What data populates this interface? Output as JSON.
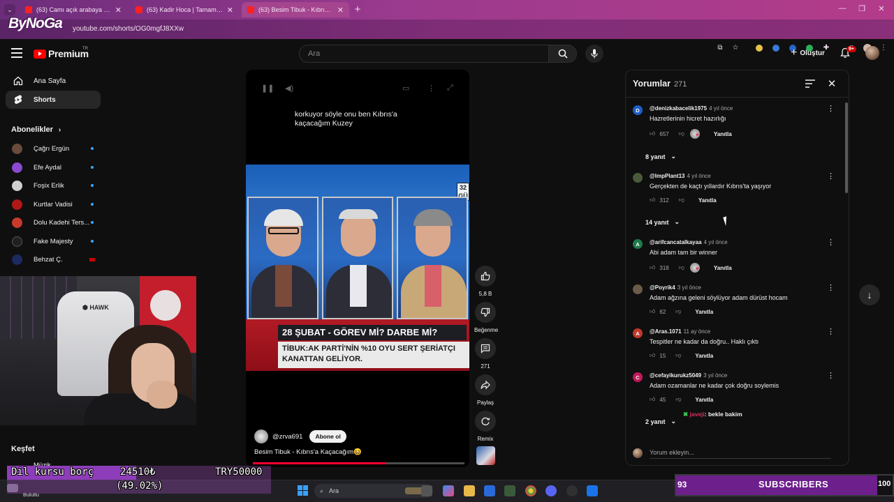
{
  "browser": {
    "tabs": [
      {
        "title": "(63) Camı açık arabaya yavrular",
        "active": false
      },
      {
        "title": "(63) Kadir Hoca | Tamam Olum",
        "active": false
      },
      {
        "title": "(63) Besim Tibuk - Kıbrıs'a K",
        "active": true
      }
    ],
    "brand_overlay": "ByNoGa",
    "url": "youtube.com/shorts/OG0mgfJ8XXw"
  },
  "topbar": {
    "logo_text": "Premium",
    "country": "TR",
    "search_placeholder": "Ara",
    "create_label": "Oluştur",
    "notif_badge": "9+"
  },
  "sidebar": {
    "items": [
      {
        "label": "Ana Sayfa",
        "icon": "home-icon"
      },
      {
        "label": "Shorts",
        "icon": "shorts-icon"
      }
    ],
    "subscriptions_heading": "Abonelikler",
    "subscriptions": [
      {
        "name": "Çağrı Ergün",
        "color": "#6a4a3a"
      },
      {
        "name": "Efe Aydal",
        "color": "#8a4ad0"
      },
      {
        "name": "Foşix Erlik",
        "color": "#d0d0d0"
      },
      {
        "name": "Kurtlar Vadisi",
        "color": "#b01818"
      },
      {
        "name": "Dolu Kadehi Ters...",
        "color": "#c83a2a"
      },
      {
        "name": "Fake Majesty",
        "color": "#202020"
      },
      {
        "name": "Behzat Ç.",
        "color": "#1c2a60"
      }
    ],
    "explore_heading": "Keşfet",
    "music_label": "Müzik"
  },
  "short": {
    "caption": "korkuyor söyle onu ben Kıbrıs'a kaçacağım Kuzey",
    "clip_tag": "32 GÜ",
    "banner_top": "28 ŞUBAT - GÖREV Mİ? DARBE Mİ?",
    "banner_bottom": "TİBUK:AK PARTİ'NİN %10 OYU SERT ŞERİATÇI KANATTAN GELİYOR.",
    "channel": "@zrva691",
    "subscribe_label": "Abone ol",
    "title": "Besim Tibuk - Kıbrıs'a Kaçacağım😆",
    "progress": 0.63,
    "actions": {
      "likes": "5,8 B",
      "dislike_label": "Beğenme",
      "comments": "271",
      "share_label": "Paylaş",
      "remix_label": "Remix"
    }
  },
  "comments": {
    "title": "Yorumlar",
    "count": "271",
    "input_placeholder": "Yorum ekleyin...",
    "reply_label": "Yanıtla",
    "items": [
      {
        "user": "@denizkabacelik1975",
        "time": "4 yıl önce",
        "text": "Hazretlerinin hicret hazırlığı",
        "likes": "657",
        "avatar_letter": "D",
        "avatar_color": "#1e5ec8",
        "creator_heart": true,
        "replies": "8 yanıt"
      },
      {
        "user": "@ImpPlant13",
        "time": "4 yıl önce",
        "text": "Gerçekten de kaçtı yıllardır Kıbrıs'ta yaşıyor",
        "likes": "312",
        "avatar_letter": "",
        "avatar_color": "#4a5a3a",
        "creator_heart": false,
        "replies": "14 yanıt"
      },
      {
        "user": "@arifcancatalkayaa",
        "time": "4 yıl önce",
        "text": "Abi adam tam bir winner",
        "likes": "318",
        "avatar_letter": "A",
        "avatar_color": "#1e7a4a",
        "creator_heart": true,
        "replies": ""
      },
      {
        "user": "@Poyrik4",
        "time": "3 yıl önce",
        "text": "Adam ağzına geleni söylüyor adam dürüst hocam",
        "likes": "62",
        "avatar_letter": "",
        "avatar_color": "#6a5a4a",
        "creator_heart": false,
        "replies": ""
      },
      {
        "user": "@Aras.1071",
        "time": "11 ay önce",
        "text": "Tespitler ne kadar da doğru.. Haklı çıktı",
        "likes": "15",
        "avatar_letter": "A",
        "avatar_color": "#c0392b",
        "creator_heart": false,
        "replies": ""
      },
      {
        "user": "@cefayikurukz5049",
        "time": "3 yıl önce",
        "text": "Adam ozamanlar ne kadar çok doğru soylemis",
        "likes": "45",
        "avatar_letter": "C",
        "avatar_color": "#c2185b",
        "creator_heart": false,
        "replies": "2 yanıt"
      }
    ]
  },
  "stream_overlay": {
    "chat_user": "javeji",
    "chat_message": ": bekle bakim",
    "debt_label": "Dil kursu borç",
    "debt_amount": "24510₺",
    "debt_target": "TRY50000",
    "debt_percent": "(49.02%)",
    "debt_fraction": 0.4902,
    "subs_count": "93",
    "subs_label": "SUBSCRIBERS",
    "subs_goal": "100",
    "subs_fraction": 0.93
  },
  "taskbar": {
    "weather_label": "Bulutlu",
    "search_label": "Ara"
  }
}
